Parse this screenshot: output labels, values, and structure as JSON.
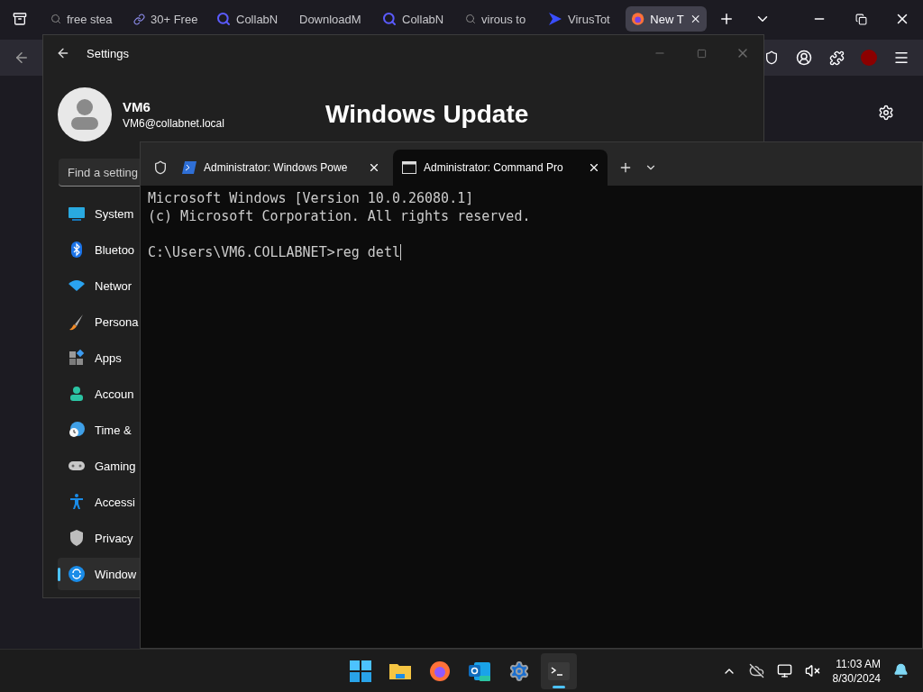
{
  "browser": {
    "tabs": [
      {
        "label": "free stea",
        "kind": "search",
        "selected": false
      },
      {
        "label": "30+ Free",
        "kind": "link",
        "selected": false
      },
      {
        "label": "CollabN",
        "kind": "collab",
        "selected": false
      },
      {
        "label": "DownloadM",
        "kind": "none",
        "selected": false
      },
      {
        "label": "CollabN",
        "kind": "collab",
        "selected": false
      },
      {
        "label": "virous to",
        "kind": "search",
        "selected": false
      },
      {
        "label": "VirusTot",
        "kind": "virustotal",
        "selected": false
      },
      {
        "label": "New T",
        "kind": "firefox",
        "selected": true
      }
    ]
  },
  "settings_window": {
    "title": "Settings",
    "user": {
      "name": "VM6",
      "email": "VM6@collabnet.local"
    },
    "heading": "Windows Update",
    "search": {
      "placeholder": "Find a setting"
    },
    "nav": [
      {
        "label": "System",
        "kind": "system",
        "selected": false
      },
      {
        "label": "Bluetoo",
        "kind": "bluetooth",
        "selected": false
      },
      {
        "label": "Networ",
        "kind": "network",
        "selected": false
      },
      {
        "label": "Persona",
        "kind": "personalization",
        "selected": false
      },
      {
        "label": "Apps",
        "kind": "apps",
        "selected": false
      },
      {
        "label": "Accoun",
        "kind": "accounts",
        "selected": false
      },
      {
        "label": "Time &",
        "kind": "time",
        "selected": false
      },
      {
        "label": "Gaming",
        "kind": "gaming",
        "selected": false
      },
      {
        "label": "Accessi",
        "kind": "accessibility",
        "selected": false
      },
      {
        "label": "Privacy",
        "kind": "privacy",
        "selected": false
      },
      {
        "label": "Window",
        "kind": "update",
        "selected": true
      }
    ]
  },
  "terminal": {
    "tabs": [
      {
        "label": "Administrator: Windows Powe",
        "kind": "powershell",
        "selected": false
      },
      {
        "label": "Administrator: Command Pro",
        "kind": "cmd",
        "selected": true
      }
    ],
    "output": [
      "Microsoft Windows [Version 10.0.26080.1]",
      "(c) Microsoft Corporation. All rights reserved."
    ],
    "prompt": "C:\\Users\\VM6.COLLABNET>reg detl"
  },
  "taskbar": {
    "apps": [
      {
        "kind": "start",
        "selected": false
      },
      {
        "kind": "explorer",
        "selected": false
      },
      {
        "kind": "firefox",
        "selected": false
      },
      {
        "kind": "outlook",
        "selected": false
      },
      {
        "kind": "settings",
        "selected": false
      },
      {
        "kind": "terminal",
        "selected": true
      }
    ],
    "clock": {
      "time": "11:03 AM",
      "date": "8/30/2024"
    }
  }
}
